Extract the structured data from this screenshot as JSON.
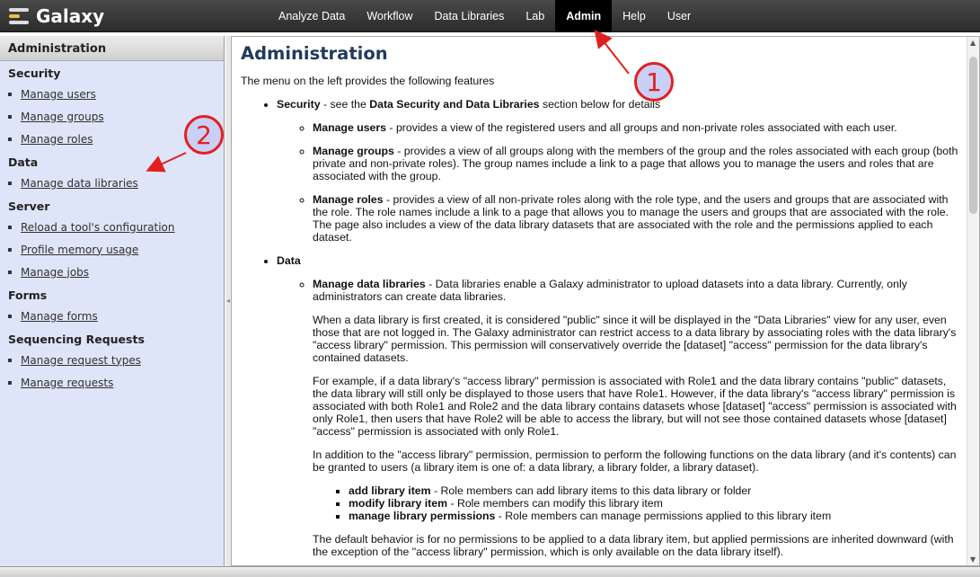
{
  "app": {
    "name": "Galaxy",
    "logo_icon": "galaxy-logo-icon"
  },
  "nav": {
    "tabs": [
      {
        "label": "Analyze Data"
      },
      {
        "label": "Workflow"
      },
      {
        "label": "Data Libraries"
      },
      {
        "label": "Lab"
      },
      {
        "label": "Admin",
        "active": true
      },
      {
        "label": "Help"
      },
      {
        "label": "User"
      }
    ]
  },
  "sidebar": {
    "title": "Administration",
    "sections": [
      {
        "title": "Security",
        "items": [
          "Manage users",
          "Manage groups",
          "Manage roles"
        ]
      },
      {
        "title": "Data",
        "items": [
          "Manage data libraries"
        ]
      },
      {
        "title": "Server",
        "items": [
          "Reload a tool's configuration",
          "Profile memory usage",
          "Manage jobs"
        ]
      },
      {
        "title": "Forms",
        "items": [
          "Manage forms"
        ]
      },
      {
        "title": "Sequencing Requests",
        "items": [
          "Manage request types",
          "Manage requests"
        ]
      }
    ]
  },
  "main": {
    "title": "Administration",
    "intro": "The menu on the left provides the following features",
    "security": {
      "label": "Security",
      "text_a": " - see the ",
      "link_bold": "Data Security and Data Libraries",
      "text_b": " section below for details",
      "items": [
        {
          "term": "Manage users",
          "desc": " - provides a view of the registered users and all groups and non-private roles associated with each user."
        },
        {
          "term": "Manage groups",
          "desc": " - provides a view of all groups along with the members of the group and the roles associated with each group (both private and non-private roles). The group names include a link to a page that allows you to manage the users and roles that are associated with the group."
        },
        {
          "term": "Manage roles",
          "desc": " - provides a view of all non-private roles along with the role type, and the users and groups that are associated with the role. The role names include a link to a page that allows you to manage the users and groups that are associated with the role. The page also includes a view of the data library datasets that are associated with the role and the permissions applied to each dataset."
        }
      ]
    },
    "data": {
      "label": "Data",
      "libraries_term": "Manage data libraries",
      "libraries_desc": " - Data libraries enable a Galaxy administrator to upload datasets into a data library. Currently, only administrators can create data libraries.",
      "para1": "When a data library is first created, it is considered \"public\" since it will be displayed in the \"Data Libraries\" view for any user, even those that are not logged in. The Galaxy administrator can restrict access to a data library by associating roles with the data library's \"access library\" permission. This permission will conservatively override the [dataset] \"access\" permission for the data library's contained datasets.",
      "para2": "For example, if a data library's \"access library\" permission is associated with Role1 and the data library contains \"public\" datasets, the data library will still only be displayed to those users that have Role1. However, if the data library's \"access library\" permission is associated with both Role1 and Role2 and the data library contains datasets whose [dataset] \"access\" permission is associated with only Role1, then users that have Role2 will be able to access the library, but will not see those contained datasets whose [dataset] \"access\" permission is associated with only Role1.",
      "para3": "In addition to the \"access library\" permission, permission to perform the following functions on the data library (and it's contents) can be granted to users (a library item is one of: a data library, a library folder, a library dataset).",
      "perms": [
        {
          "term": "add library item",
          "desc": " - Role members can add library items to this data library or folder"
        },
        {
          "term": "modify library item",
          "desc": " - Role members can modify this library item"
        },
        {
          "term": "manage library permissions",
          "desc": " - Role members can manage permissions applied to this library item"
        }
      ],
      "para4": "The default behavior is for no permissions to be applied to a data library item, but applied permissions are inherited downward (with the exception of the \"access library\" permission, which is only available on the data library itself)."
    }
  },
  "callouts": [
    "1",
    "2"
  ],
  "colors": {
    "callout_border": "#e02020",
    "callout_fill": "#c9cff5",
    "sidebar_bg": "#dfe5f9",
    "title": "#223a5e"
  }
}
